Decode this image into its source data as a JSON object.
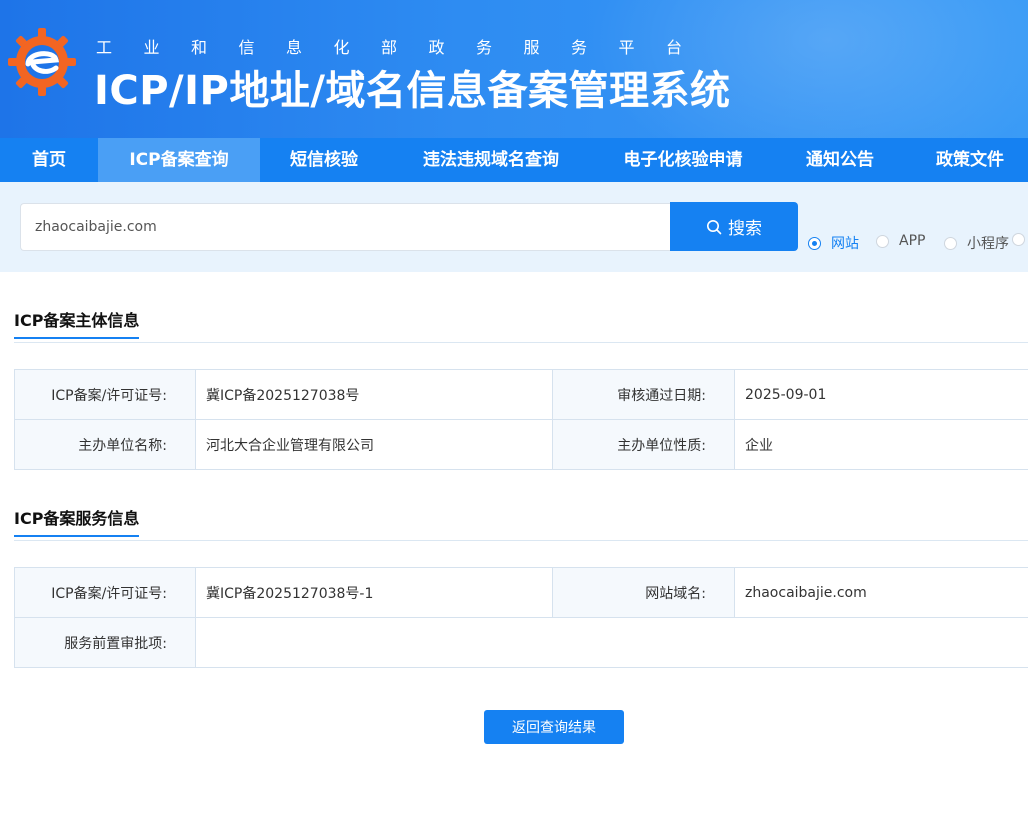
{
  "header": {
    "subtitle": "工业和信息化部政务服务平台",
    "title": "ICP/IP地址/域名信息备案管理系统",
    "logo_icon": "miit-gear-logo-icon",
    "colors": {
      "brand_blue": "#1581f2",
      "logo_orange": "#f26522"
    }
  },
  "nav": {
    "items": [
      {
        "label": "首页"
      },
      {
        "label": "ICP备案查询",
        "active": true
      },
      {
        "label": "短信核验"
      },
      {
        "label": "违法违规域名查询"
      },
      {
        "label": "电子化核验申请"
      },
      {
        "label": "通知公告"
      },
      {
        "label": "政策文件"
      }
    ]
  },
  "search": {
    "value": "zhaocaibajie.com",
    "button_label": "搜索",
    "button_icon": "search-icon",
    "options": [
      {
        "label": "网站",
        "checked": true
      },
      {
        "label": "APP",
        "checked": false
      },
      {
        "label": "小程序",
        "checked": false
      }
    ]
  },
  "subject_section": {
    "title": "ICP备案主体信息",
    "rows": [
      {
        "label1": "ICP备案/许可证号:",
        "value1": "冀ICP备2025127038号",
        "label2": "审核通过日期:",
        "value2": "2025-09-01"
      },
      {
        "label1": "主办单位名称:",
        "value1": "河北大合企业管理有限公司",
        "label2": "主办单位性质:",
        "value2": "企业"
      }
    ]
  },
  "service_section": {
    "title": "ICP备案服务信息",
    "rows": [
      {
        "label1": "ICP备案/许可证号:",
        "value1": "冀ICP备2025127038号-1",
        "label2": "网站域名:",
        "value2": "zhaocaibajie.com"
      },
      {
        "label1": "服务前置审批项:",
        "value1": ""
      }
    ]
  },
  "back_button": {
    "label": "返回查询结果"
  }
}
